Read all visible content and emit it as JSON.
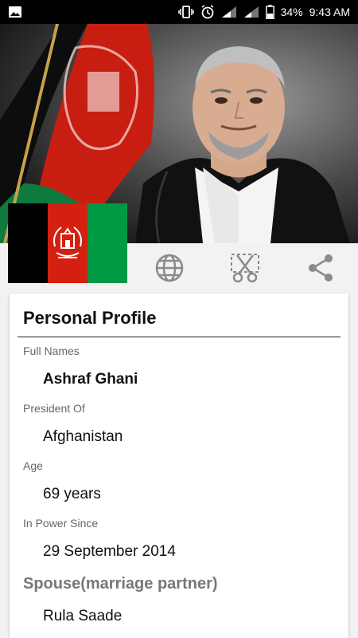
{
  "status_bar": {
    "battery": "34%",
    "time": "9:43 AM",
    "icons": [
      "image-icon",
      "vibrate-icon",
      "alarm-icon",
      "signal-icon",
      "signal-icon",
      "battery-icon"
    ]
  },
  "hero": {
    "image": "portrait-photo"
  },
  "actions": [
    {
      "name": "globe-icon"
    },
    {
      "name": "scissors-icon"
    },
    {
      "name": "share-icon"
    }
  ],
  "profile": {
    "title": "Personal Profile",
    "full_names_label": "Full Names",
    "full_names": "Ashraf Ghani",
    "president_of_label": "President Of",
    "president_of": "Afghanistan",
    "age_label": "Age",
    "age": "69 years",
    "in_power_label": "In Power Since",
    "in_power": "29 September 2014",
    "spouse_title": "Spouse(marriage partner)",
    "spouse": "Rula Saade"
  },
  "colors": {
    "flag_black": "#000000",
    "flag_red": "#d32011",
    "flag_green": "#009a44",
    "icon_gray": "#8a8a8a"
  }
}
